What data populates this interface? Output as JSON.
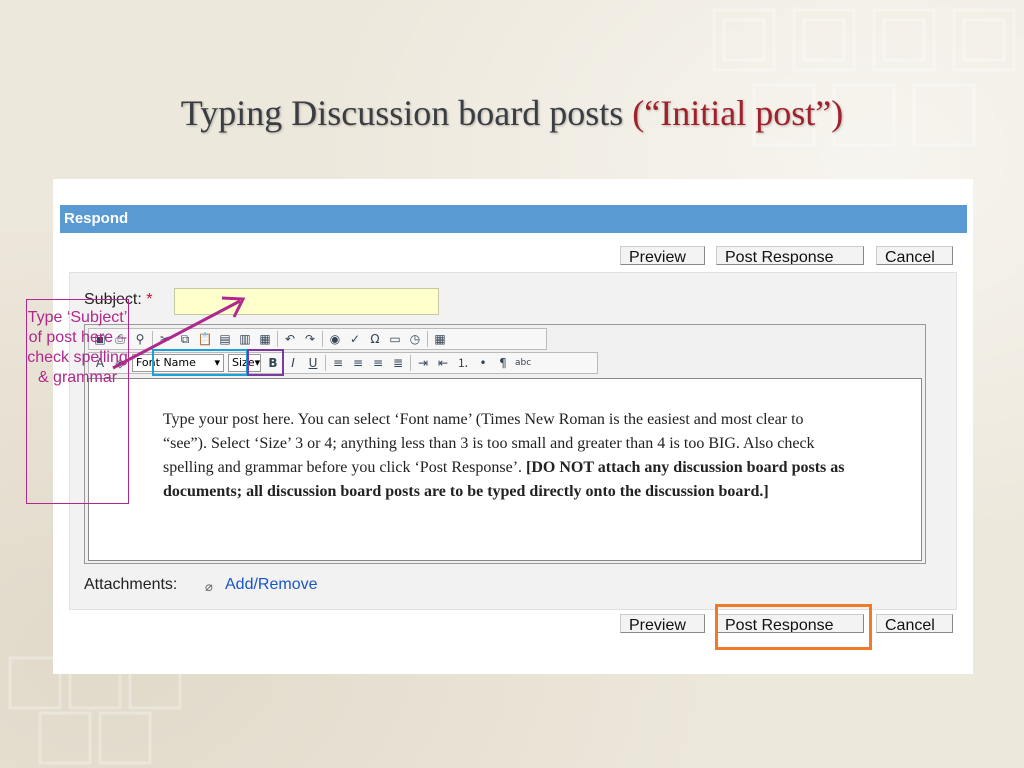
{
  "slide": {
    "title_main": "Typing Discussion board posts",
    "title_accent": "(“Initial post”)"
  },
  "respond": {
    "header": "Respond",
    "preview_label": "Preview",
    "post_response_label": "Post Response",
    "cancel_label": "Cancel"
  },
  "form": {
    "subject_label": "Subject:",
    "required_marker": "*",
    "subject_value": "",
    "font_name_select": "Font Name",
    "size_select": "Size",
    "body_text": "Type your post here.  You can select ‘Font name’ (Times New Roman is the easiest and most clear to “see”).  Select ‘Size’ 3 or 4; anything less than 3 is too small and greater than 4 is too BIG.  Also check spelling and grammar before you click ‘Post Response’. ",
    "body_bold": "[DO NOT attach any discussion board posts as documents; all discussion board posts are to be typed directly onto the discussion board.]",
    "attachments_label": "Attachments:",
    "add_remove_link": "Add/Remove"
  },
  "toolbar": {
    "row1_icons": [
      "source-icon",
      "print-icon",
      "find-icon",
      "cut-icon",
      "copy-icon",
      "paste-icon",
      "paste-text-icon",
      "paste-word-icon",
      "spellcheck-format-icon",
      "undo-icon",
      "redo-icon",
      "link-icon",
      "spellcheck-icon",
      "special-char-icon",
      "template-icon",
      "datetime-icon",
      "table-icon"
    ],
    "row2_icons": [
      "text-color-icon",
      "highlight-icon",
      "bold-icon",
      "italic-icon",
      "underline-icon",
      "align-left-icon",
      "align-center-icon",
      "align-right-icon",
      "justify-icon",
      "indent-icon",
      "outdent-icon",
      "ordered-list-icon",
      "bullet-list-icon",
      "paragraph-icon",
      "strikethrough-icon"
    ]
  },
  "callout": {
    "text": "Type ‘Subject’ of post here – check spelling & grammar"
  },
  "colors": {
    "respond_bar": "#5a9ad3",
    "callout": "#b0288c",
    "font_highlight": "#1aa2d8",
    "size_highlight": "#7a3aa0",
    "post_highlight": "#f07a28",
    "title_accent": "#a0202b"
  }
}
